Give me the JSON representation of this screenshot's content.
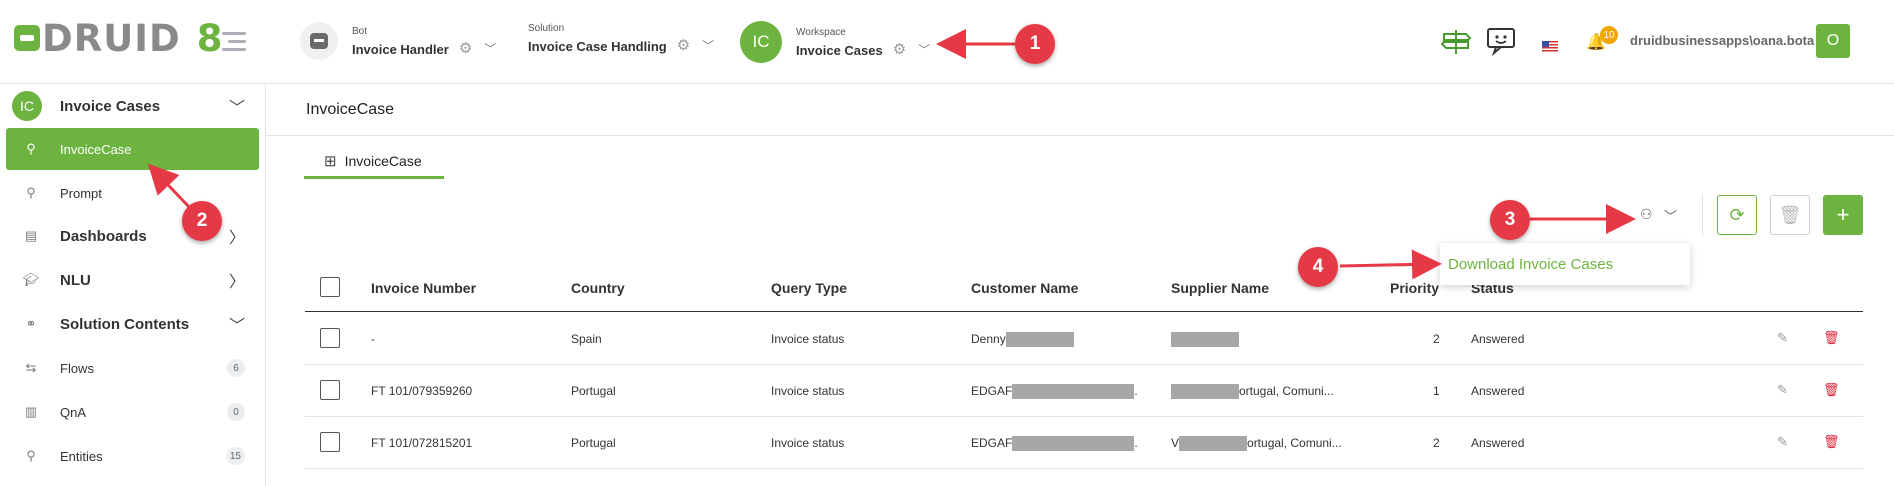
{
  "app": {
    "logo_text": "DRUID",
    "logo_version": "8"
  },
  "header": {
    "bot": {
      "caption": "Bot",
      "value": "Invoice Handler"
    },
    "solution": {
      "caption": "Solution",
      "value": "Invoice Case Handling"
    },
    "workspace": {
      "caption": "Workspace",
      "value": "Invoice Cases",
      "initials": "IC"
    },
    "notification_count": "10",
    "username": "druidbusinessapps\\oana.bota",
    "avatar_initial": "O"
  },
  "sidebar": {
    "workspace_initials": "IC",
    "workspace_label": "Invoice Cases",
    "items": [
      {
        "label": "InvoiceCase",
        "icon": "entity-icon",
        "active": true
      },
      {
        "label": "Prompt",
        "icon": "entity-icon"
      },
      {
        "label": "Dashboards",
        "icon": "dashboard-icon"
      },
      {
        "label": "NLU",
        "icon": "graduation-cap-icon"
      },
      {
        "label": "Solution Contents",
        "icon": "hierarchy-icon"
      },
      {
        "label": "Flows",
        "icon": "flow-icon",
        "count": "6"
      },
      {
        "label": "QnA",
        "icon": "book-icon",
        "count": "0"
      },
      {
        "label": "Entities",
        "icon": "entity-icon",
        "count": "15"
      }
    ]
  },
  "main": {
    "page_title": "InvoiceCase",
    "tab_label": "InvoiceCase",
    "dropdown_item": "Download Invoice Cases"
  },
  "table": {
    "columns": [
      "Invoice Number",
      "Country",
      "Query Type",
      "Customer Name",
      "Supplier Name",
      "Priority",
      "Status"
    ],
    "rows": [
      {
        "invoice_number": "-",
        "country": "Spain",
        "query_type": "Invoice status",
        "customer_prefix": "Denny",
        "customer_suffix": "",
        "supplier_prefix": "",
        "supplier_suffix": "",
        "priority": "2",
        "status": "Answered"
      },
      {
        "invoice_number": "FT 101/079359260",
        "country": "Portugal",
        "query_type": "Invoice status",
        "customer_prefix": "EDGAF",
        "customer_suffix": ".",
        "supplier_prefix": "",
        "supplier_suffix": "ortugal, Comuni...",
        "priority": "1",
        "status": "Answered"
      },
      {
        "invoice_number": "FT 101/072815201",
        "country": "Portugal",
        "query_type": "Invoice status",
        "customer_prefix": "EDGAF",
        "customer_suffix": ".",
        "supplier_prefix": "V",
        "supplier_suffix": "ortugal, Comuni...",
        "priority": "2",
        "status": "Answered"
      }
    ]
  },
  "annotations": [
    "1",
    "2",
    "3",
    "4"
  ],
  "colors": {
    "brand_green": "#6db33f",
    "annotation_red": "#e63946",
    "delete_red": "#e0243a"
  }
}
